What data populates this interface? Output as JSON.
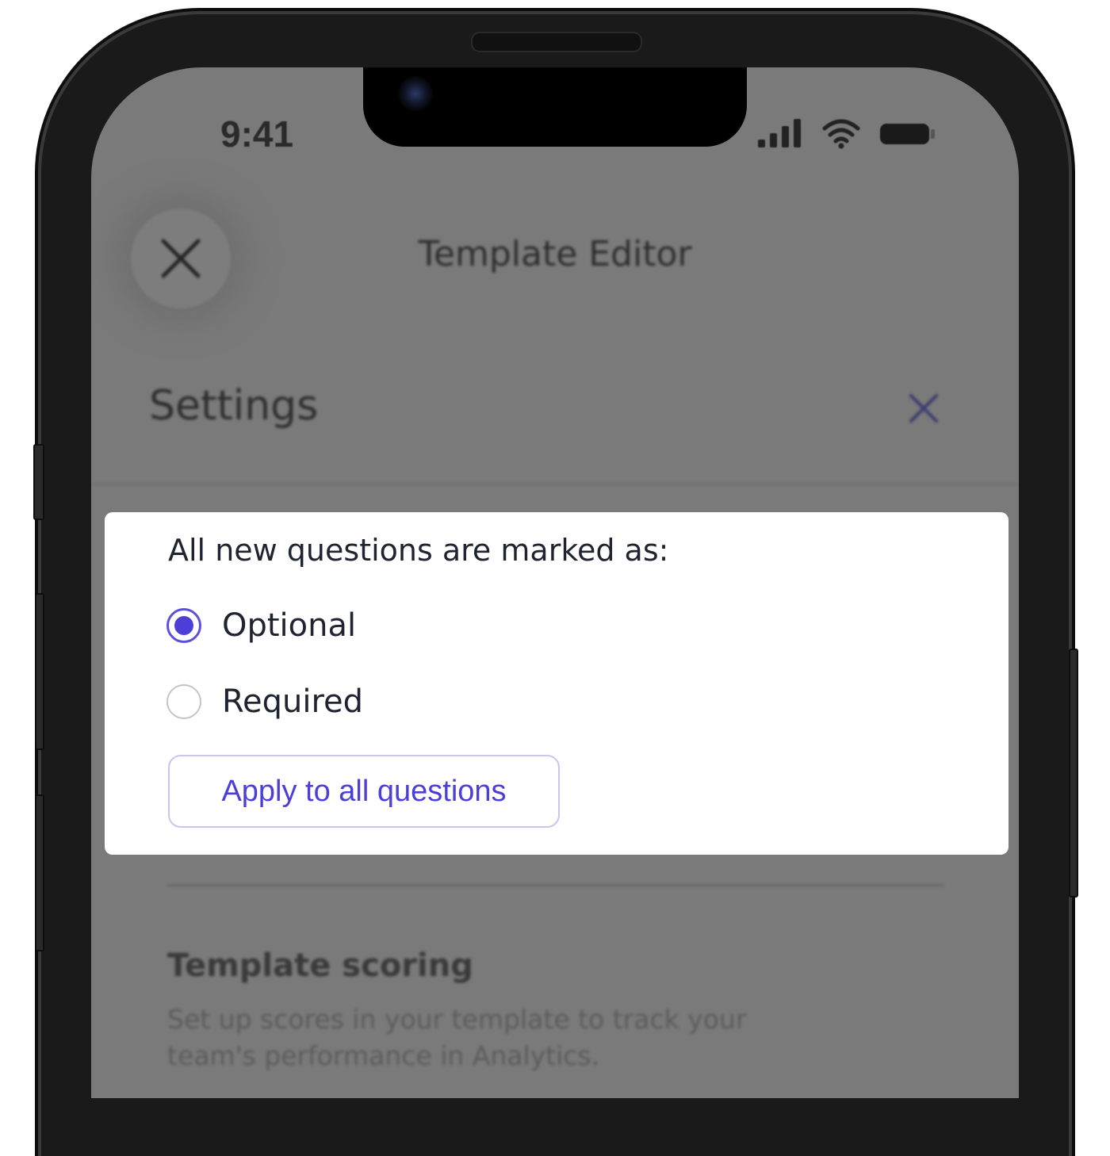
{
  "status_bar": {
    "time": "9:41"
  },
  "nav": {
    "title": "Template Editor"
  },
  "settings": {
    "title": "Settings"
  },
  "sheet": {
    "label": "All new questions are marked as:",
    "options": [
      {
        "label": "Optional",
        "selected": true
      },
      {
        "label": "Required",
        "selected": false
      }
    ],
    "apply_label": "Apply to all questions"
  },
  "scoring": {
    "title": "Template scoring",
    "description": "Set up scores in your template to track your team's performance in Analytics."
  },
  "colors": {
    "accent": "#4b3fd8",
    "overlay": "#7a7a7a",
    "sheet": "#ffffff"
  }
}
